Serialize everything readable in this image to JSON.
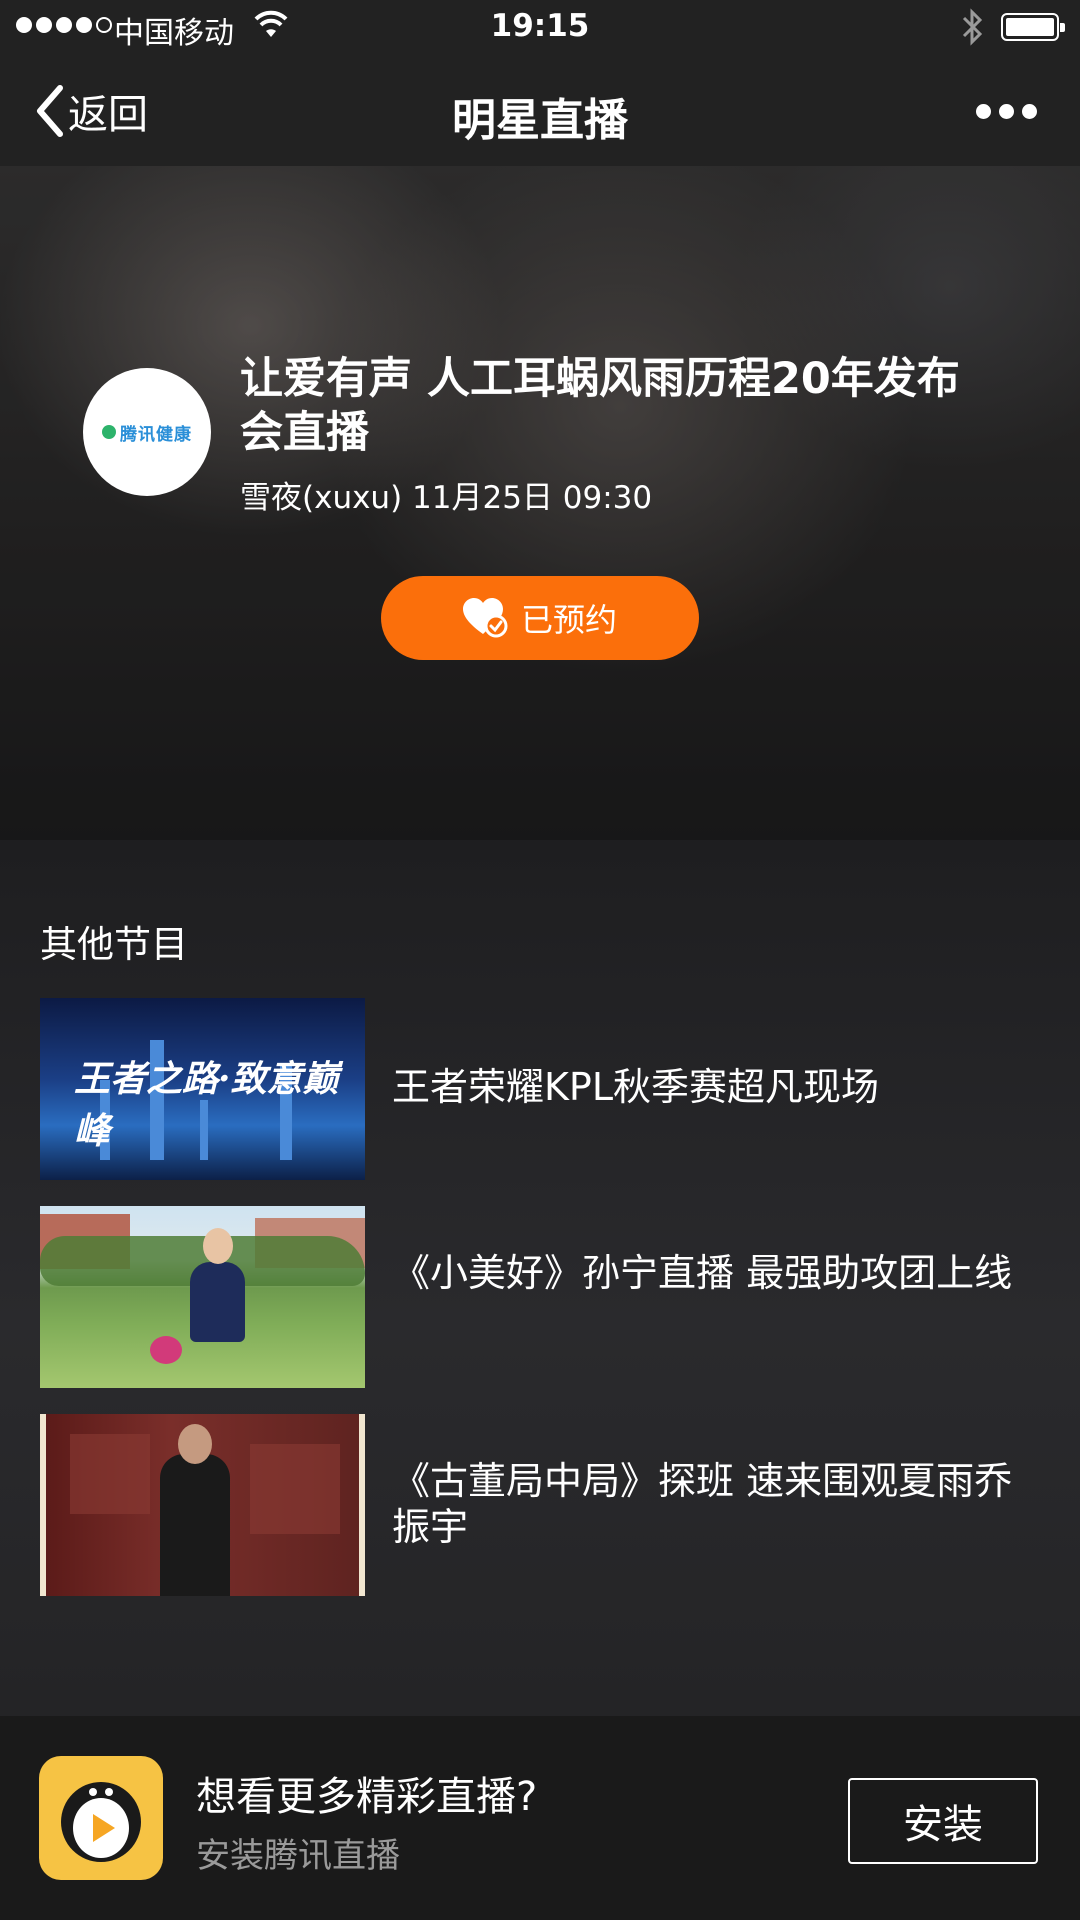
{
  "status_bar": {
    "carrier": "中国移动",
    "time": "19:15"
  },
  "nav": {
    "back_label": "返回",
    "title": "明星直播"
  },
  "live": {
    "title": "让爱有声 人工耳蜗风雨历程20年发布会直播",
    "host": "雪夜(xuxu)",
    "datetime": "11月25日 09:30",
    "meta": "雪夜(xuxu) 11月25日 09:30",
    "reserve_label": "已预约",
    "host_logo_text": "腾讯健康"
  },
  "other_programs": {
    "section_title": "其他节目",
    "items": [
      {
        "title": "王者荣耀KPL秋季赛超凡现场"
      },
      {
        "title": "《小美好》孙宁直播 最强助攻团上线"
      },
      {
        "title": "《古董局中局》探班 速来围观夏雨乔振宇"
      }
    ]
  },
  "banner": {
    "title": "想看更多精彩直播?",
    "subtitle": "安装腾讯直播",
    "install_label": "安装"
  },
  "colors": {
    "accent_orange": "#fb6f0b",
    "background": "#1c1c1e",
    "app_icon_yellow": "#f6c344"
  }
}
